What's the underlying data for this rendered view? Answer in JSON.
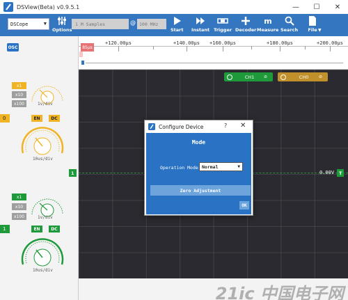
{
  "window": {
    "title": "DSView(Beta) v0.9.5.1",
    "controls": [
      "—",
      "☐",
      "✕"
    ]
  },
  "toolbar": {
    "device": "DSCope",
    "options_label": "Options",
    "samples": "1 M Samples",
    "at": "@",
    "rate": "100 MHz",
    "start_label": "Start",
    "instant_label": "Instant",
    "trigger_label": "Trigger",
    "decoder_label": "Decoder",
    "measure_label": "Measure",
    "search_label": "Search",
    "file_label": "File"
  },
  "ruler": {
    "cursor": "85μs",
    "ticks": [
      "+120.00μs",
      "+140.00μs",
      "+160.00μs",
      "+180.00μs",
      "+200.00μs"
    ]
  },
  "left_panel": {
    "mode_badge": "OSC",
    "ch1": {
      "ranges": [
        "x1",
        "x10",
        "x100"
      ],
      "vdiv": "1v/div",
      "en": "EN",
      "coupling": "DC",
      "edge_value": "0",
      "tdiv": "10us/div"
    },
    "ch0": {
      "ranges": [
        "x1",
        "x10",
        "x100"
      ],
      "vdiv": "1v/div",
      "en": "EN",
      "coupling": "DC",
      "edge_value": "1",
      "tdiv": "10us/div"
    },
    "colors": {
      "ch1": "#f0b323",
      "ch0": "#1f9a3a",
      "inactive": "#9e9e9e"
    }
  },
  "scope": {
    "chip_ch1": "CH1",
    "chip_ch0": "CH0",
    "left_marker": "1",
    "right_marker": "T",
    "readout": "0.00V",
    "watermark": "21ic 中国电子网"
  },
  "dialog": {
    "title": "Configure Device",
    "help": "?",
    "close": "✕",
    "heading": "Mode",
    "mode_label": "Operation Mode",
    "mode_value": "Normal",
    "zero_button": "Zero Adjustment",
    "ok": "OK"
  }
}
